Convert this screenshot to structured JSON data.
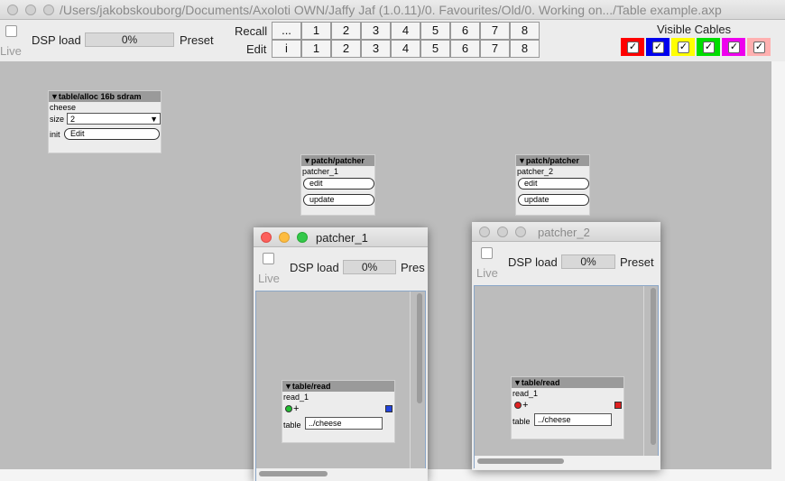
{
  "window": {
    "title": "/Users/jakobskouborg/Documents/Axoloti OWN/Jaffy Jaf (1.0.11)/0. Favourites/Old/0. Working on.../Table example.axp"
  },
  "toolbar": {
    "live_label": "Live",
    "dsp_label": "DSP load",
    "dsp_value": "0%",
    "preset_label": "Preset",
    "recall_label": "Recall",
    "edit_label": "Edit",
    "recall_buttons": [
      "...",
      "1",
      "2",
      "3",
      "4",
      "5",
      "6",
      "7",
      "8"
    ],
    "edit_buttons": [
      "i",
      "1",
      "2",
      "3",
      "4",
      "5",
      "6",
      "7",
      "8"
    ],
    "visible_cables_label": "Visible Cables",
    "cable_colors": [
      "#ff0000",
      "#0000ee",
      "#ffff00",
      "#00dd00",
      "#ee00ee",
      "#ffb0b0"
    ],
    "cable_check": "✓"
  },
  "objects": {
    "table_alloc": {
      "type": "table/alloc 16b sdram",
      "name": "cheese",
      "size_label": "size",
      "size_value": "2",
      "init_label": "init",
      "edit_button": "Edit"
    },
    "patcher1": {
      "type": "patch/patcher",
      "name": "patcher_1",
      "edit_button": "edit",
      "update_button": "update"
    },
    "patcher2": {
      "type": "patch/patcher",
      "name": "patcher_2",
      "edit_button": "edit",
      "update_button": "update"
    }
  },
  "subwindows": [
    {
      "title": "patcher_1",
      "live_label": "Live",
      "dsp_label": "DSP load",
      "dsp_value": "0%",
      "preset_label": "Pres",
      "object": {
        "type": "table/read",
        "name": "read_1",
        "plus": "+",
        "table_label": "table",
        "table_value": "../cheese"
      }
    },
    {
      "title": "patcher_2",
      "live_label": "Live",
      "dsp_label": "DSP load",
      "dsp_value": "0%",
      "preset_label": "Preset",
      "object": {
        "type": "table/read",
        "name": "read_1",
        "plus": "+",
        "table_label": "table",
        "table_value": "../cheese"
      }
    }
  ],
  "icons": {
    "collapse": "▼",
    "dropdown": "▼"
  }
}
